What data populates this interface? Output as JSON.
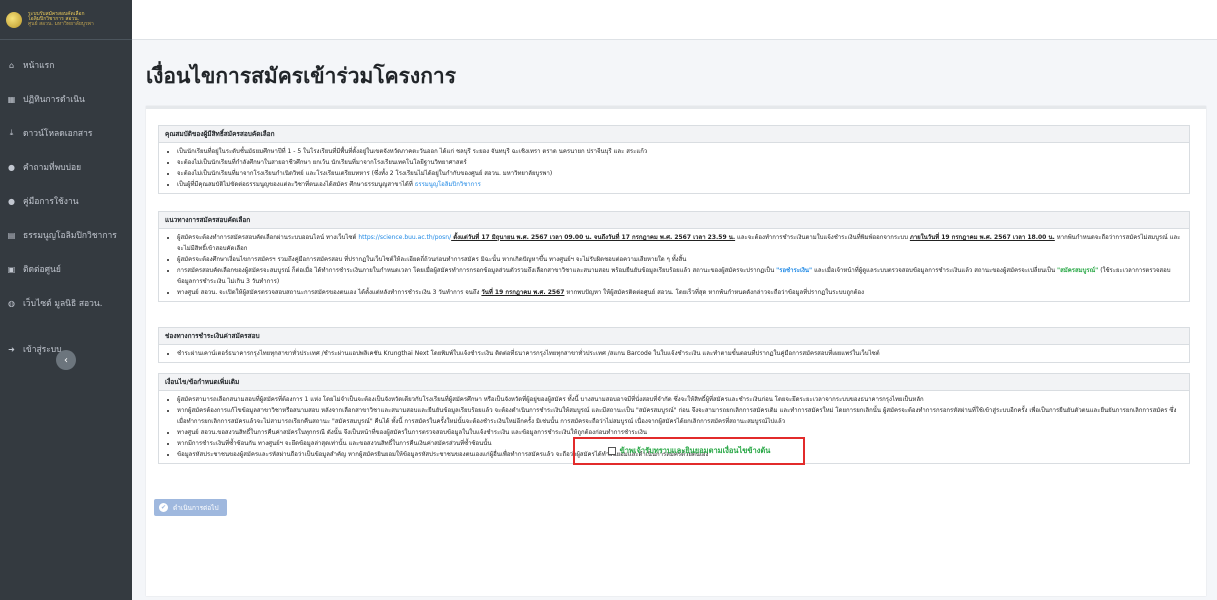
{
  "brand": {
    "line1": "ระบบรับสมัครสอบคัดเลือก",
    "line2": "โอลิมปิกวิชาการ สอวน.",
    "line3": "ศูนย์ สอวน. มหาวิทยาลัยบูรพา"
  },
  "sidebar": {
    "items": [
      {
        "label": "หน้าแรก",
        "icon": "home-icon"
      },
      {
        "label": "ปฏิทินการดำเนิน",
        "icon": "calendar-icon"
      },
      {
        "label": "ดาวน์โหลดเอกสาร",
        "icon": "download-icon"
      },
      {
        "label": "คำถามที่พบบ่อย",
        "icon": "question-icon"
      },
      {
        "label": "คู่มือการใช้งาน",
        "icon": "help-icon"
      },
      {
        "label": "ธรรมนูญโอลิมปิกวิชาการ",
        "icon": "book-icon"
      },
      {
        "label": "ติดต่อศูนย์",
        "icon": "contact-icon"
      },
      {
        "label": "เว็บไซต์ มูลนิธิ สอวน.",
        "icon": "globe-icon"
      },
      {
        "label": "เข้าสู่ระบบ",
        "icon": "sign-in-icon"
      }
    ],
    "collapse_icon": "chevron-left-icon"
  },
  "page": {
    "title": "เงื่อนไขการสมัครเข้าร่วมโครงการ"
  },
  "sections": {
    "s1": {
      "title": "คุณสมบัติของผู้มีสิทธิ์สมัครสอบคัดเลือก",
      "items": [
        "เป็นนักเรียนที่อยู่ในระดับชั้นมัธยมศึกษาปีที่ 1 - 5 ในโรงเรียนที่มีพื้นที่ตั้งอยู่ในเขตจังหวัดภาคตะวันออก ได้แก่ ชลบุรี ระยอง จันทบุรี ฉะเชิงเทรา ตราด นครนายก ปราจีนบุรี และ สระแก้ว",
        "จะต้องไม่เป็นนักเรียนที่กำลังศึกษาในสายอาชีวศึกษา ยกเว้น นักเรียนที่มาจากโรงเรียนเทคโนโลยีฐานวิทยาศาสตร์",
        "จะต้องไม่เป็นนักเรียนที่มาจากโรงเรียนกำเนิดวิทย์ และโรงเรียนเตรียมทหาร (ซึ่งทั้ง 2 โรงเรียนไม่ได้อยู่ในกำกับของศูนย์ สอวน. มหาวิทยาลัยบูรพา)"
      ],
      "item4_prefix": "เป็นผู้ที่มีคุณสมบัติไม่ขัดต่อธรรมนูญของแต่ละวิชาที่ตนเองได้สมัคร ศึกษาธรรมนูญสาขาได้ที่ ",
      "item4_link": "ธรรมนูญโอลิมปิกวิชาการ"
    },
    "s2": {
      "title": "แนวทางการสมัครสอบคัดเลือก",
      "b1_a": "ผู้สมัครจะต้องทำการสมัครสอบคัดเลือกผ่านระบบออนไลน์ ทางเว็บไซต์ ",
      "b1_url": "https://science.buu.ac.th/posn/",
      "b1_b": " ตั้งแต่วันที่ 17 มิถุนายน พ.ศ. 2567 เวลา 09.00 น. จนถึงวันที่ 17 กรกฎาคม พ.ศ. 2567 เวลา 23.59 น.",
      "b1_c": " และจะต้องทำการชำระเงินตามใบแจ้งชำระเงินที่พิมพ์ออกจากระบบ ",
      "b1_d": "ภายในวันที่ 19 กรกฎาคม พ.ศ. 2567 เวลา 18.00 น.",
      "b1_e": " หากพ้นกำหนดจะถือว่าการสมัครไม่สมบูรณ์ และจะไม่มีสิทธิ์เข้าสอบคัดเลือก",
      "b2": "ผู้สมัครจะต้องศึกษาเงื่อนไขการสมัครฯ รวมถึงคู่มือการสมัครสอบ ที่ปรากฏในเว็บไซต์ให้ละเอียดถี่ถ้วนก่อนทำการสมัคร มิฉะนั้น หากเกิดปัญหาขึ้น ทางศูนย์ฯ จะไม่รับผิดชอบต่อความเสียหายใด ๆ ทั้งสิ้น",
      "b3_a": "การสมัครสอบคัดเลือกของผู้สมัครจะสมบูรณ์ ก็ต่อเมื่อ ได้ทำการชำระเงินภายในกำหนดเวลา โดยเมื่อผู้สมัครทำการกรอกข้อมูลส่วนตัวรวมถึงเลือกสาขาวิชาและสนามสอบ พร้อมยืนยันข้อมูลเรียบร้อยแล้ว สถานะของผู้สมัครจะปรากฏเป็น ",
      "b3_status1": "\"รอชำระเงิน\"",
      "b3_b": " และเมื่อเจ้าหน้าที่ผู้ดูแลระบบตรวจสอบข้อมูลการชำระเงินแล้ว สถานะของผู้สมัครจะเปลี่ยนเป็น ",
      "b3_status2": "\"สมัครสมบูรณ์\"",
      "b3_c": " (ใช้ระยะเวลาการตรวจสอบข้อมูลการชำระเงิน ไม่เกิน 3 วันทำการ)",
      "b4_a": "ทางศูนย์ สอวน. จะเปิดให้ผู้สมัครตรวจสอบสถานะการสมัครของตนเอง ได้ตั้งแต่หลังทำการชำระเงิน 3 วันทำการ จนถึง ",
      "b4_date": "วันที่ 19 กรกฎาคม พ.ศ. 2567",
      "b4_b": " หากพบปัญหา ให้ผู้สมัครติดต่อศูนย์ สอวน. โดยเร็วที่สุด หากพ้นกำหนดดังกล่าวจะถือว่าข้อมูลที่ปรากฏในระบบถูกต้อง"
    },
    "s3": {
      "title": "ช่องทางการชำระเงินค่าสมัครสอบ",
      "items": [
        "ชำระผ่านเคาน์เตอร์ธนาคารกรุงไทยทุกสาขาทั่วประเทศ /ชำระผ่านแอปพลิเคชัน Krungthai Next โดยพิมพ์ใบแจ้งชำระเงิน ติดต่อที่ธนาคารกรุงไทยทุกสาขาทั่วประเทศ /สแกน Barcode ในใบแจ้งชำระเงิน และทำตามขั้นตอนที่ปรากฏในคู่มือการสมัครสอบที่เผยแพร่ในเว็บไซต์"
      ]
    },
    "s4": {
      "title": "เงื่อนไข/ข้อกำหนดเพิ่มเติม",
      "items": [
        "ผู้สมัครสามารถเลือกสนามสอบที่ผู้สมัครที่ต้องการ 1 แห่ง โดยไม่จำเป็นจะต้องเป็นจังหวัดเดียวกับโรงเรียนที่ผู้สมัครศึกษา หรือเป็นจังหวัดที่ผู้อยู่ของผู้สมัคร ทั้งนี้ บางสนามสอบอาจมีที่นั่งสอบที่จำกัด ซึ่งจะให้สิทธิ์ผู้ที่สมัครและชำระเงินก่อน โดยจะยึดระยะเวลาจากระบบของธนาคารกรุงไทยเป็นหลัก",
        "หากผู้สมัครต้องการแก้ไขข้อมูลสาขาวิชาหรือสนามสอบ หลังจากเลือกสาขาวิชาและสนามสอบและยืนยันข้อมูลเรียบร้อยแล้ว จะต้องดำเนินการชำระเงินให้สมบูรณ์ และมีสถานะเป็น \"สมัครสมบูรณ์\" ก่อน จึงจะสามารถยกเลิกการสมัครเดิม และทำการสมัครใหม่ โดยการยกเลิกนั้น ผู้สมัครจะต้องทำการกรอกรหัสผ่านที่ใช้เข้าสู่ระบบอีกครั้ง เพื่อเป็นการยืนยันตัวตนและยืนยันการยกเลิกการสมัคร ซึ่งเมื่อทำการยกเลิกการสมัครแล้วจะไม่สามารถเรียกคืนสถานะ \"สมัครสมบูรณ์\" คืนได้ ทั้งนี้ การสมัครในครั้งใหม่นั้นจะต้องชำระเงินใหม่อีกครั้ง มิเช่นนั้น การสมัครจะถือว่าไม่สมบูรณ์ เนื่องจากผู้สมัครได้ยกเลิกการสมัครที่สถานะสมบูรณ์ไปแล้ว",
        "ทางศูนย์ สอวน.ขอสงวนสิทธิ์ในการคืนค่าสมัครในทุกกรณี ดังนั้น จึงเป็นหน้าที่ของผู้สมัครในการตรวจสอบข้อมูลในใบแจ้งชำระเงิน และข้อมูลการชำระเงินให้ถูกต้องก่อนทำการชำระเงิน",
        "หากมีการชำระเงินที่ซ้ำซ้อนกัน ทางศูนย์ฯ จะยึดข้อมูลล่าสุดเท่านั้น และขอสงวนสิทธิ์ในการคืนเงินค่าสมัครส่วนที่ซ้ำซ้อนนั้น",
        "ข้อมูลรหัสประชาชนของผู้สมัครและรหัสผ่านถือว่าเป็นข้อมูลสำคัญ หากผู้สมัครยินยอมให้ข้อมูลรหัสประชาชนของตนเองแก่ผู้อื่นเพื่อทำการสมัครแล้ว จะถือว่าผู้สมัครได้ทำยินยอมและดำเนินการสมัครด้วยตนเอง"
      ]
    }
  },
  "consent": {
    "label": "ข้าพเจ้ารับทราบและยินยอมตามเงื่อนไขข้างต้น",
    "checked": false
  },
  "actions": {
    "proceed_label": "ดำเนินการต่อไป",
    "proceed_icon": "check-circle-icon"
  },
  "colors": {
    "sidebar_bg": "#343a40",
    "link": "#1e88e5",
    "status_green": "#28a745",
    "highlight_border": "#e22b2b",
    "button_disabled": "#9fb8de"
  }
}
